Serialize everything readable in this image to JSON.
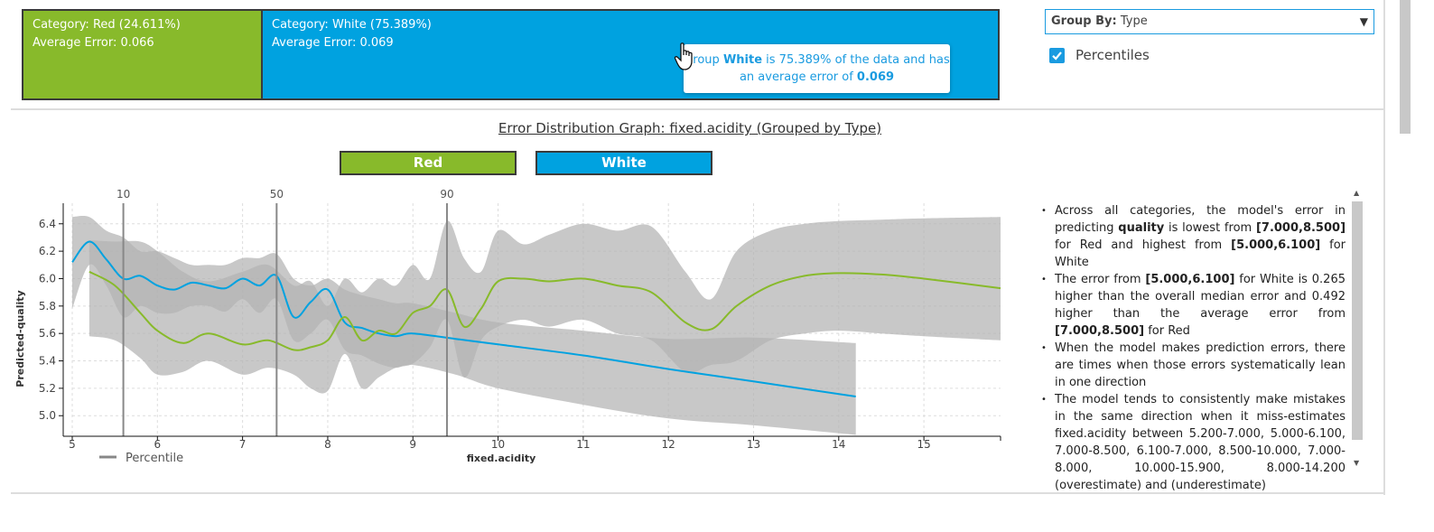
{
  "categories": {
    "red": {
      "line1": "Category: Red (24.611%)",
      "line2": "Average Error: 0.066"
    },
    "white": {
      "line1": "Category: White (75.389%)",
      "line2": "Average Error: 0.069"
    }
  },
  "tooltip": {
    "t1": "Group ",
    "group": "White",
    "t2": " is 75.389% of the data and has an average error of ",
    "error": "0.069"
  },
  "controls": {
    "group_by_label": "Group By:",
    "group_by_value": "Type",
    "percentiles_label": "Percentiles",
    "percentiles_checked": true
  },
  "chart_title": "Error Distribution Graph: fixed.acidity (Grouped by Type)",
  "legend": {
    "red": "Red",
    "white": "White",
    "percentile": "Percentile"
  },
  "colors": {
    "red": "#88ba2b",
    "white": "#00a2e0",
    "band": "#b3b3b3",
    "percentile_line": "#888888"
  },
  "chart_data": {
    "type": "line",
    "title": "Error Distribution Graph: fixed.acidity (Grouped by Type)",
    "xlabel": "fixed.acidity",
    "ylabel": "Predicted-quality",
    "xlim": [
      5,
      15.9
    ],
    "ylim": [
      4.85,
      6.55
    ],
    "x_ticks": [
      5,
      6,
      7,
      8,
      9,
      10,
      11,
      12,
      13,
      14,
      15
    ],
    "y_ticks": [
      5.0,
      5.2,
      5.4,
      5.6,
      5.8,
      6.0,
      6.2,
      6.4
    ],
    "grid": true,
    "percentiles": [
      {
        "label": "10",
        "x": 5.6
      },
      {
        "label": "50",
        "x": 7.4
      },
      {
        "label": "90",
        "x": 9.4
      }
    ],
    "series": [
      {
        "name": "White",
        "color": "#00a2e0",
        "x": [
          5.0,
          5.2,
          5.4,
          5.6,
          5.8,
          6.0,
          6.2,
          6.4,
          6.6,
          6.8,
          7.0,
          7.2,
          7.4,
          7.6,
          7.8,
          8.0,
          8.2,
          8.4,
          8.6,
          8.8,
          9.0,
          9.5,
          10.0,
          11.0,
          12.0,
          13.0,
          14.2
        ],
        "y": [
          6.12,
          6.27,
          6.14,
          6.0,
          6.02,
          5.95,
          5.92,
          5.97,
          5.95,
          5.93,
          6.0,
          5.95,
          6.02,
          5.72,
          5.83,
          5.92,
          5.68,
          5.64,
          5.6,
          5.58,
          5.6,
          5.56,
          5.52,
          5.44,
          5.34,
          5.25,
          5.14
        ],
        "upper": [
          6.45,
          6.45,
          6.35,
          6.3,
          6.2,
          6.2,
          6.15,
          6.1,
          6.1,
          6.1,
          6.15,
          6.15,
          6.18,
          6.0,
          5.95,
          6.0,
          5.92,
          5.88,
          5.85,
          5.82,
          5.82,
          5.75,
          5.68,
          5.62,
          5.56,
          5.57,
          5.53
        ],
        "lower": [
          5.78,
          6.1,
          5.95,
          5.72,
          5.8,
          5.75,
          5.75,
          5.8,
          5.8,
          5.76,
          5.85,
          5.75,
          5.85,
          5.55,
          5.6,
          5.7,
          5.48,
          5.44,
          5.38,
          5.35,
          5.37,
          5.3,
          5.2,
          5.08,
          4.98,
          4.93,
          4.86
        ]
      },
      {
        "name": "Red",
        "color": "#88ba2b",
        "x": [
          5.2,
          5.5,
          5.8,
          6.0,
          6.3,
          6.6,
          7.0,
          7.3,
          7.6,
          7.8,
          8.0,
          8.2,
          8.4,
          8.6,
          8.8,
          9.0,
          9.2,
          9.4,
          9.6,
          9.8,
          10.0,
          10.3,
          10.6,
          11.0,
          11.4,
          11.8,
          12.2,
          12.5,
          12.8,
          13.2,
          13.6,
          14.0,
          14.5,
          15.0,
          15.9
        ],
        "y": [
          6.05,
          5.95,
          5.75,
          5.62,
          5.53,
          5.6,
          5.52,
          5.55,
          5.48,
          5.5,
          5.55,
          5.72,
          5.55,
          5.62,
          5.6,
          5.75,
          5.8,
          5.92,
          5.65,
          5.78,
          5.98,
          6.0,
          5.98,
          6.0,
          5.95,
          5.9,
          5.68,
          5.63,
          5.8,
          5.95,
          6.02,
          6.04,
          6.03,
          6.0,
          5.93
        ],
        "upper": [
          6.28,
          6.27,
          6.27,
          6.2,
          6.05,
          5.98,
          6.05,
          6.1,
          5.95,
          5.98,
          5.8,
          6.0,
          5.9,
          6.0,
          5.95,
          6.1,
          6.0,
          6.42,
          6.15,
          6.05,
          6.35,
          6.25,
          6.32,
          6.4,
          6.35,
          6.38,
          6.05,
          5.85,
          6.2,
          6.35,
          6.4,
          6.42,
          6.43,
          6.44,
          6.45
        ],
        "lower": [
          5.58,
          5.55,
          5.42,
          5.3,
          5.32,
          5.4,
          5.3,
          5.35,
          5.3,
          5.2,
          5.18,
          5.45,
          5.2,
          5.28,
          5.35,
          5.38,
          5.5,
          5.7,
          5.28,
          5.55,
          5.65,
          5.7,
          5.65,
          5.7,
          5.6,
          5.55,
          5.32,
          5.37,
          5.4,
          5.55,
          5.6,
          5.62,
          5.6,
          5.58,
          5.55
        ]
      }
    ]
  },
  "insights": [
    {
      "parts": [
        {
          "t": "Across all categories, the model's error in predicting "
        },
        {
          "t": "quality",
          "b": true
        },
        {
          "t": " is lowest from "
        },
        {
          "t": "[7.000,8.500]",
          "b": true
        },
        {
          "t": " for Red and highest from "
        },
        {
          "t": "[5.000,6.100]",
          "b": true
        },
        {
          "t": " for White"
        }
      ]
    },
    {
      "parts": [
        {
          "t": "The error from "
        },
        {
          "t": "[5.000,6.100]",
          "b": true
        },
        {
          "t": " for White is 0.265 higher than the overall median error and 0.492 higher than the average error from "
        },
        {
          "t": "[7.000,8.500]",
          "b": true
        },
        {
          "t": " for Red"
        }
      ]
    },
    {
      "parts": [
        {
          "t": "When the model makes prediction errors, there are times when those errors systematically lean in one direction"
        }
      ]
    },
    {
      "parts": [
        {
          "t": "The model tends to consistently make mistakes in the same direction when it miss-estimates fixed.acidity between 5.200-7.000, 5.000-6.100, 7.000-8.500, 6.100-7.000, 8.500-10.000, 7.000-8.000, 10.000-15.900, 8.000-14.200 (overestimate) and (underestimate)"
        }
      ]
    }
  ]
}
